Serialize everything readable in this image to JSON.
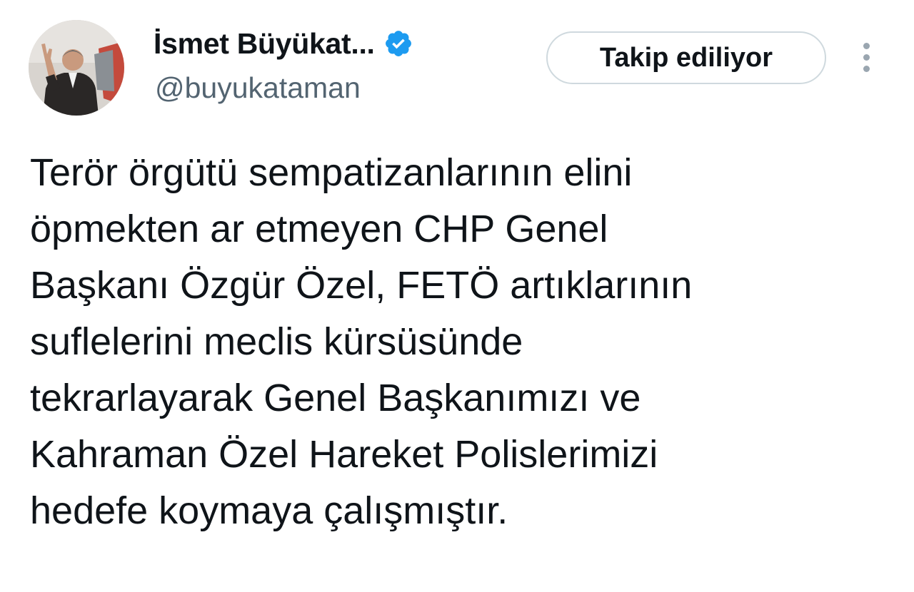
{
  "author": {
    "display_name": "İsmet Büyükat...",
    "handle": "@buyukataman",
    "verified_icon": "verified-badge-icon",
    "avatar_icon": "avatar-photo"
  },
  "actions": {
    "follow_label": "Takip ediliyor",
    "more_icon": "more-vertical-icon"
  },
  "tweet": {
    "lines": [
      "Terör örgütü sempatizanlarının elini",
      "öpmekten ar etmeyen CHP Genel",
      "Başkanı Özgür Özel, FETÖ artıklarının",
      "suflelerini meclis kürsüsünde",
      "tekrarlayarak Genel Başkanımızı ve",
      "Kahraman Özel Hareket Polislerimizi",
      "hedefe koymaya çalışmıştır."
    ]
  },
  "colors": {
    "verified": "#1d9bf0",
    "handle": "#536471",
    "text": "#0f1419",
    "button_border": "#cfd9de"
  }
}
